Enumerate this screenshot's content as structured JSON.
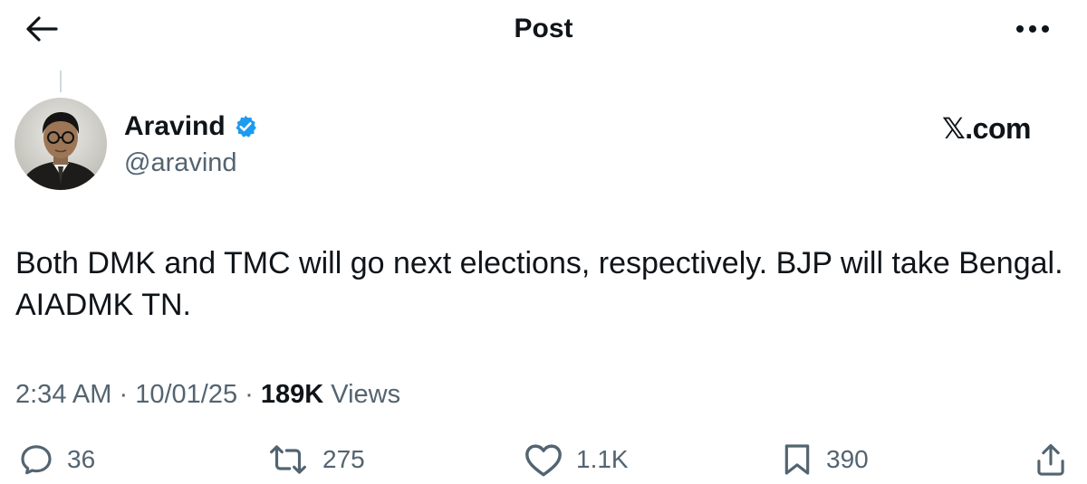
{
  "header": {
    "title": "Post"
  },
  "author": {
    "name": "Aravind",
    "handle": "@aravind",
    "verified": true
  },
  "brand_watermark": {
    "x_glyph": "𝕏",
    "text": ".com"
  },
  "tweet": {
    "text": "Both DMK and TMC will go next elections, respectively. BJP will take Bengal. AIADMK TN."
  },
  "meta": {
    "time": "2:34 AM",
    "sep1": " · ",
    "date": "10/01/25",
    "sep2": " · ",
    "views_count": "189K",
    "views_label": " Views"
  },
  "actions": {
    "replies": "36",
    "reposts": "275",
    "likes": "1.1K",
    "bookmarks": "390"
  },
  "colors": {
    "text": "#0f1419",
    "secondary": "#536471",
    "verified": "#1d9bf0",
    "divider": "#cfd9de"
  },
  "icons": [
    "back-arrow-icon",
    "more-icon",
    "verified-badge-icon",
    "reply-icon",
    "repost-icon",
    "like-icon",
    "bookmark-icon",
    "share-icon"
  ]
}
